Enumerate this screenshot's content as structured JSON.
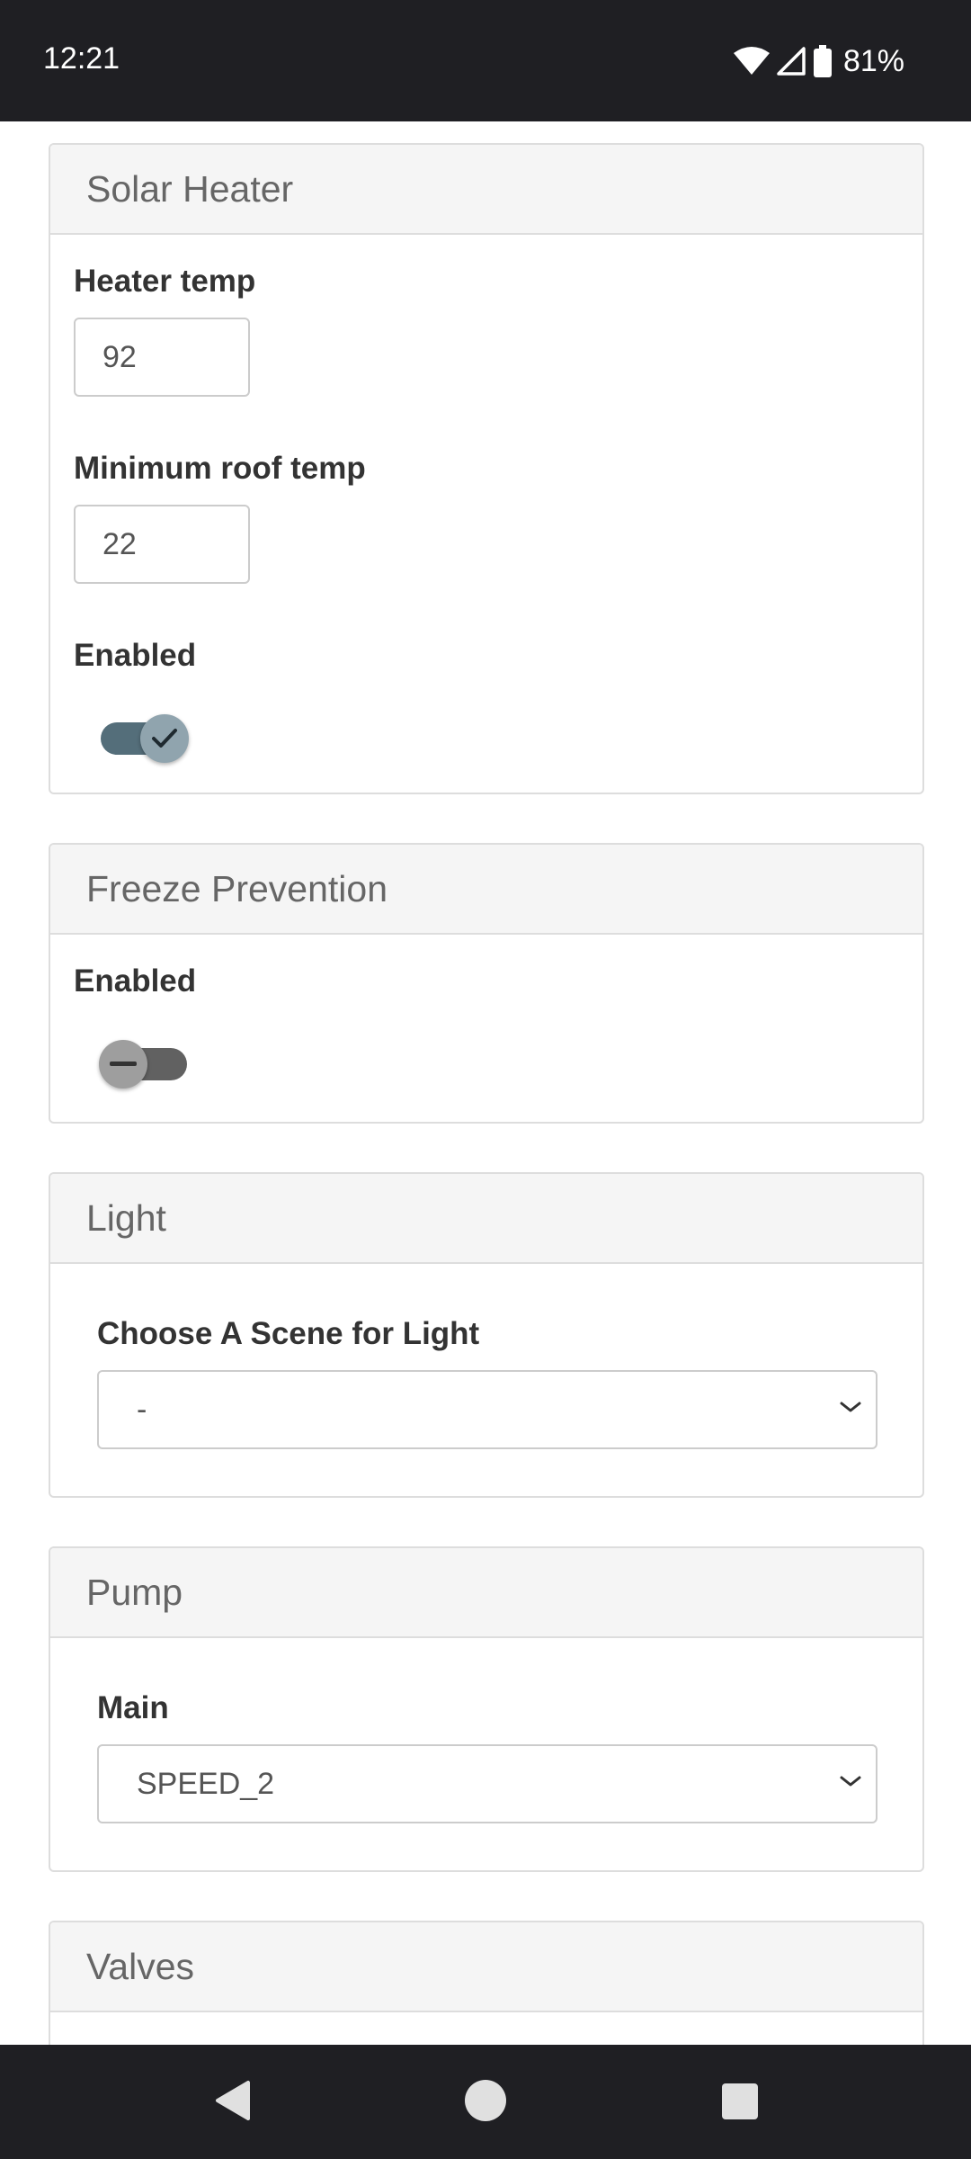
{
  "status_bar": {
    "time": "12:21",
    "battery": "81%"
  },
  "sections": {
    "solar_heater": {
      "title": "Solar Heater",
      "heater_temp_label": "Heater temp",
      "heater_temp_value": "92",
      "min_roof_temp_label": "Minimum roof temp",
      "min_roof_temp_value": "22",
      "enabled_label": "Enabled",
      "enabled": true
    },
    "freeze_prevention": {
      "title": "Freeze Prevention",
      "enabled_label": "Enabled",
      "enabled": false
    },
    "light": {
      "title": "Light",
      "scene_label": "Choose A Scene for Light",
      "scene_value": "-"
    },
    "pump": {
      "title": "Pump",
      "main_label": "Main",
      "main_value": "SPEED_2"
    },
    "valves": {
      "title": "Valves"
    }
  },
  "colors": {
    "toggle_on_track": "#546e7a",
    "toggle_on_knob": "#90a4ae",
    "toggle_off_track": "#616161",
    "toggle_off_knob": "#9e9e9e",
    "system_bars": "#1f1f23"
  },
  "icons": [
    "wifi-icon",
    "cell-signal-icon",
    "battery-icon",
    "check-icon",
    "minus-icon",
    "chevron-down-icon",
    "back-icon",
    "home-icon",
    "recents-icon"
  ]
}
